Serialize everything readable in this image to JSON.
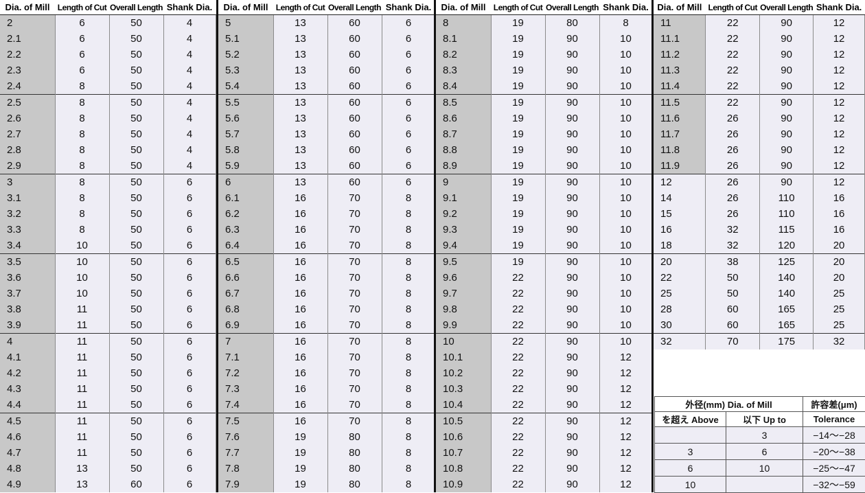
{
  "headers": {
    "dia": "Dia. of Mill",
    "cut": "Length of Cut",
    "overall": "Overall Length",
    "shank": "Shank Dia."
  },
  "blocks": [
    {
      "rows": [
        [
          "2",
          "6",
          "50",
          "4"
        ],
        [
          "2.1",
          "6",
          "50",
          "4"
        ],
        [
          "2.2",
          "6",
          "50",
          "4"
        ],
        [
          "2.3",
          "6",
          "50",
          "4"
        ],
        [
          "2.4",
          "8",
          "50",
          "4"
        ],
        [
          "2.5",
          "8",
          "50",
          "4"
        ],
        [
          "2.6",
          "8",
          "50",
          "4"
        ],
        [
          "2.7",
          "8",
          "50",
          "4"
        ],
        [
          "2.8",
          "8",
          "50",
          "4"
        ],
        [
          "2.9",
          "8",
          "50",
          "4"
        ],
        [
          "3",
          "8",
          "50",
          "6"
        ],
        [
          "3.1",
          "8",
          "50",
          "6"
        ],
        [
          "3.2",
          "8",
          "50",
          "6"
        ],
        [
          "3.3",
          "8",
          "50",
          "6"
        ],
        [
          "3.4",
          "10",
          "50",
          "6"
        ],
        [
          "3.5",
          "10",
          "50",
          "6"
        ],
        [
          "3.6",
          "10",
          "50",
          "6"
        ],
        [
          "3.7",
          "10",
          "50",
          "6"
        ],
        [
          "3.8",
          "11",
          "50",
          "6"
        ],
        [
          "3.9",
          "11",
          "50",
          "6"
        ],
        [
          "4",
          "11",
          "50",
          "6"
        ],
        [
          "4.1",
          "11",
          "50",
          "6"
        ],
        [
          "4.2",
          "11",
          "50",
          "6"
        ],
        [
          "4.3",
          "11",
          "50",
          "6"
        ],
        [
          "4.4",
          "11",
          "50",
          "6"
        ],
        [
          "4.5",
          "11",
          "50",
          "6"
        ],
        [
          "4.6",
          "11",
          "50",
          "6"
        ],
        [
          "4.7",
          "11",
          "50",
          "6"
        ],
        [
          "4.8",
          "13",
          "50",
          "6"
        ],
        [
          "4.9",
          "13",
          "60",
          "6"
        ]
      ]
    },
    {
      "rows": [
        [
          "5",
          "13",
          "60",
          "6"
        ],
        [
          "5.1",
          "13",
          "60",
          "6"
        ],
        [
          "5.2",
          "13",
          "60",
          "6"
        ],
        [
          "5.3",
          "13",
          "60",
          "6"
        ],
        [
          "5.4",
          "13",
          "60",
          "6"
        ],
        [
          "5.5",
          "13",
          "60",
          "6"
        ],
        [
          "5.6",
          "13",
          "60",
          "6"
        ],
        [
          "5.7",
          "13",
          "60",
          "6"
        ],
        [
          "5.8",
          "13",
          "60",
          "6"
        ],
        [
          "5.9",
          "13",
          "60",
          "6"
        ],
        [
          "6",
          "13",
          "60",
          "6"
        ],
        [
          "6.1",
          "16",
          "70",
          "8"
        ],
        [
          "6.2",
          "16",
          "70",
          "8"
        ],
        [
          "6.3",
          "16",
          "70",
          "8"
        ],
        [
          "6.4",
          "16",
          "70",
          "8"
        ],
        [
          "6.5",
          "16",
          "70",
          "8"
        ],
        [
          "6.6",
          "16",
          "70",
          "8"
        ],
        [
          "6.7",
          "16",
          "70",
          "8"
        ],
        [
          "6.8",
          "16",
          "70",
          "8"
        ],
        [
          "6.9",
          "16",
          "70",
          "8"
        ],
        [
          "7",
          "16",
          "70",
          "8"
        ],
        [
          "7.1",
          "16",
          "70",
          "8"
        ],
        [
          "7.2",
          "16",
          "70",
          "8"
        ],
        [
          "7.3",
          "16",
          "70",
          "8"
        ],
        [
          "7.4",
          "16",
          "70",
          "8"
        ],
        [
          "7.5",
          "16",
          "70",
          "8"
        ],
        [
          "7.6",
          "19",
          "80",
          "8"
        ],
        [
          "7.7",
          "19",
          "80",
          "8"
        ],
        [
          "7.8",
          "19",
          "80",
          "8"
        ],
        [
          "7.9",
          "19",
          "80",
          "8"
        ]
      ]
    },
    {
      "rows": [
        [
          "8",
          "19",
          "80",
          "8"
        ],
        [
          "8.1",
          "19",
          "90",
          "10"
        ],
        [
          "8.2",
          "19",
          "90",
          "10"
        ],
        [
          "8.3",
          "19",
          "90",
          "10"
        ],
        [
          "8.4",
          "19",
          "90",
          "10"
        ],
        [
          "8.5",
          "19",
          "90",
          "10"
        ],
        [
          "8.6",
          "19",
          "90",
          "10"
        ],
        [
          "8.7",
          "19",
          "90",
          "10"
        ],
        [
          "8.8",
          "19",
          "90",
          "10"
        ],
        [
          "8.9",
          "19",
          "90",
          "10"
        ],
        [
          "9",
          "19",
          "90",
          "10"
        ],
        [
          "9.1",
          "19",
          "90",
          "10"
        ],
        [
          "9.2",
          "19",
          "90",
          "10"
        ],
        [
          "9.3",
          "19",
          "90",
          "10"
        ],
        [
          "9.4",
          "19",
          "90",
          "10"
        ],
        [
          "9.5",
          "19",
          "90",
          "10"
        ],
        [
          "9.6",
          "22",
          "90",
          "10"
        ],
        [
          "9.7",
          "22",
          "90",
          "10"
        ],
        [
          "9.8",
          "22",
          "90",
          "10"
        ],
        [
          "9.9",
          "22",
          "90",
          "10"
        ],
        [
          "10",
          "22",
          "90",
          "10"
        ],
        [
          "10.1",
          "22",
          "90",
          "12"
        ],
        [
          "10.2",
          "22",
          "90",
          "12"
        ],
        [
          "10.3",
          "22",
          "90",
          "12"
        ],
        [
          "10.4",
          "22",
          "90",
          "12"
        ],
        [
          "10.5",
          "22",
          "90",
          "12"
        ],
        [
          "10.6",
          "22",
          "90",
          "12"
        ],
        [
          "10.7",
          "22",
          "90",
          "12"
        ],
        [
          "10.8",
          "22",
          "90",
          "12"
        ],
        [
          "10.9",
          "22",
          "90",
          "12"
        ]
      ]
    },
    {
      "rows": [
        [
          "11",
          "22",
          "90",
          "12"
        ],
        [
          "11.1",
          "22",
          "90",
          "12"
        ],
        [
          "11.2",
          "22",
          "90",
          "12"
        ],
        [
          "11.3",
          "22",
          "90",
          "12"
        ],
        [
          "11.4",
          "22",
          "90",
          "12"
        ],
        [
          "11.5",
          "22",
          "90",
          "12"
        ],
        [
          "11.6",
          "26",
          "90",
          "12"
        ],
        [
          "11.7",
          "26",
          "90",
          "12"
        ],
        [
          "11.8",
          "26",
          "90",
          "12"
        ],
        [
          "11.9",
          "26",
          "90",
          "12"
        ],
        [
          "12",
          "26",
          "90",
          "12"
        ],
        [
          "14",
          "26",
          "110",
          "16"
        ],
        [
          "15",
          "26",
          "110",
          "16"
        ],
        [
          "16",
          "32",
          "115",
          "16"
        ],
        [
          "18",
          "32",
          "120",
          "20"
        ],
        [
          "20",
          "38",
          "125",
          "20"
        ],
        [
          "22",
          "50",
          "140",
          "20"
        ],
        [
          "25",
          "50",
          "140",
          "25"
        ],
        [
          "28",
          "60",
          "165",
          "25"
        ],
        [
          "30",
          "60",
          "165",
          "25"
        ],
        [
          "32",
          "70",
          "175",
          "32"
        ]
      ]
    }
  ],
  "tolerance": {
    "h1_dia": "外径(mm)  Dia. of Mill",
    "h1_tol": "許容差(μm)",
    "h2_above": "を超え  Above",
    "h2_upto": "以下  Up to",
    "h2_tol": "Tolerance",
    "rows": [
      [
        "",
        "3",
        "−14〜−28"
      ],
      [
        "3",
        "6",
        "−20〜−38"
      ],
      [
        "6",
        "10",
        "−25〜−47"
      ],
      [
        "10",
        "",
        "−32〜−59"
      ]
    ]
  }
}
